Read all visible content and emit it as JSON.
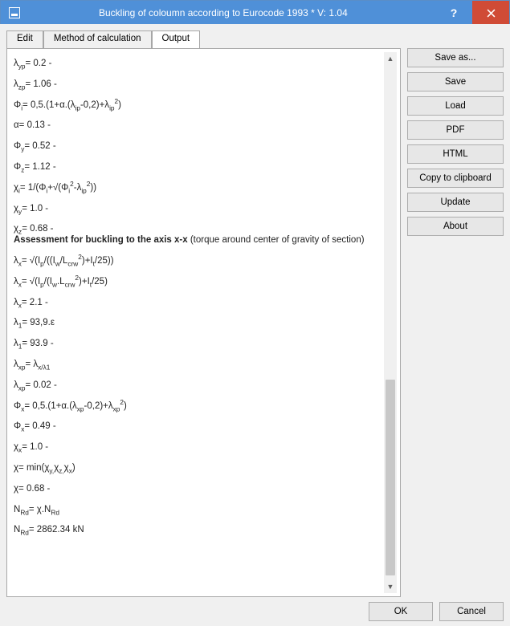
{
  "window": {
    "title": "Buckling of coloumn according to Eurocode 1993 * V: 1.04"
  },
  "tabs": {
    "edit": "Edit",
    "method": "Method of calculation",
    "output": "Output"
  },
  "sidebar": {
    "save_as": "Save as...",
    "save": "Save",
    "load": "Load",
    "pdf": "PDF",
    "html": "HTML",
    "copy_clip": "Copy to clipboard",
    "update": "Update",
    "about": "About"
  },
  "footer": {
    "ok": "OK",
    "cancel": "Cancel"
  },
  "output": {
    "l01": {
      "sym": "λ",
      "sub": "yp",
      "rhs": "= 0.2 -"
    },
    "l02": {
      "sym": "λ",
      "sub": "zp",
      "rhs": "= 1.06 -"
    },
    "l03": {
      "sym": "Φ",
      "sub": "i",
      "rhs": "= 0,5.(1+α.(λ",
      "sub2": "ip",
      "rhs2": "-0,2)+λ",
      "sub3": "ip",
      "sup3": "2",
      "rhs3": ")"
    },
    "l04": {
      "sym": "α",
      "sub": "",
      "rhs": "= 0.13 -"
    },
    "l05": {
      "sym": "Φ",
      "sub": "y",
      "rhs": "= 0.52 -"
    },
    "l06": {
      "sym": "Φ",
      "sub": "z",
      "rhs": "= 1.12 -"
    },
    "l07": {
      "sym": "χ",
      "sub": "i",
      "rhs": "= 1/(Φ",
      "sub2": "i",
      "rhs2": "+√(Φ",
      "sub3": "i",
      "sup3": "2",
      "rhs3": "-λ",
      "sub4": "ip",
      "sup4": "2",
      "rhs4": "))"
    },
    "l08": {
      "sym": "χ",
      "sub": "y",
      "rhs": "= 1.0 -"
    },
    "l09": {
      "sym": "χ",
      "sub": "z",
      "rhs": "= 0.68 -"
    },
    "heading": {
      "bold": "Assessment for buckling to the axis x-x",
      "rest": " (torque around center of gravity of section)"
    },
    "l10": {
      "sym": "λ",
      "sub": "x",
      "rhs": "= √(I",
      "sub2": "p",
      "rhs2": "/((I",
      "sub3": "w",
      "rhs3": "/L",
      "sub4": "crw",
      "sup4": "2",
      "rhs4": ")+I",
      "sub5": "t",
      "rhs5": "/25))"
    },
    "l11": {
      "sym": "λ",
      "sub": "x",
      "rhs": "= √(I",
      "sub2": "p",
      "rhs2": "/(I",
      "sub3": "w",
      "rhs3": ".L",
      "sub4": "crw",
      "sup4": "2",
      "rhs4": ")+I",
      "sub5": "t",
      "rhs5": "/25)"
    },
    "l12": {
      "sym": "λ",
      "sub": "x",
      "rhs": "= 2.1 -"
    },
    "l13": {
      "sym": "λ",
      "sub": "1",
      "rhs": "= 93,9.ε"
    },
    "l14": {
      "sym": "λ",
      "sub": "1",
      "rhs": "= 93.9 -"
    },
    "l15": {
      "sym": "λ",
      "sub": "xp",
      "rhs": "= λ",
      "sub2": "x/λ1"
    },
    "l16": {
      "sym": "λ",
      "sub": "xp",
      "rhs": "= 0.02 -"
    },
    "l17": {
      "sym": "Φ",
      "sub": "x",
      "rhs": "= 0,5.(1+α.(λ",
      "sub2": "xp",
      "rhs2": "-0,2)+λ",
      "sub3": "xp",
      "sup3": "2",
      "rhs3": ")"
    },
    "l18": {
      "sym": "Φ",
      "sub": "x",
      "rhs": "= 0.49 -"
    },
    "l19": {
      "sym": "χ",
      "sub": "x",
      "rhs": "= 1.0 -"
    },
    "l20": {
      "sym": "χ",
      "sub": "",
      "rhs": "= min(χ",
      "sub2": "y,",
      "rhs2": "χ",
      "sub3": "z,",
      "rhs3": "χ",
      "sub4": "x",
      "rhs4": ")"
    },
    "l21": {
      "sym": "χ",
      "sub": "",
      "rhs": "= 0.68 -"
    },
    "l22": {
      "sym": "N",
      "sub": "Rd",
      "rhs": "= χ.N",
      "sub2": "Rd"
    },
    "l23": {
      "sym": "N",
      "sub": "Rd",
      "rhs": "= 2862.34 kN"
    }
  },
  "scroll": {
    "thumb_top_pct": 61,
    "thumb_height_pct": 38
  }
}
